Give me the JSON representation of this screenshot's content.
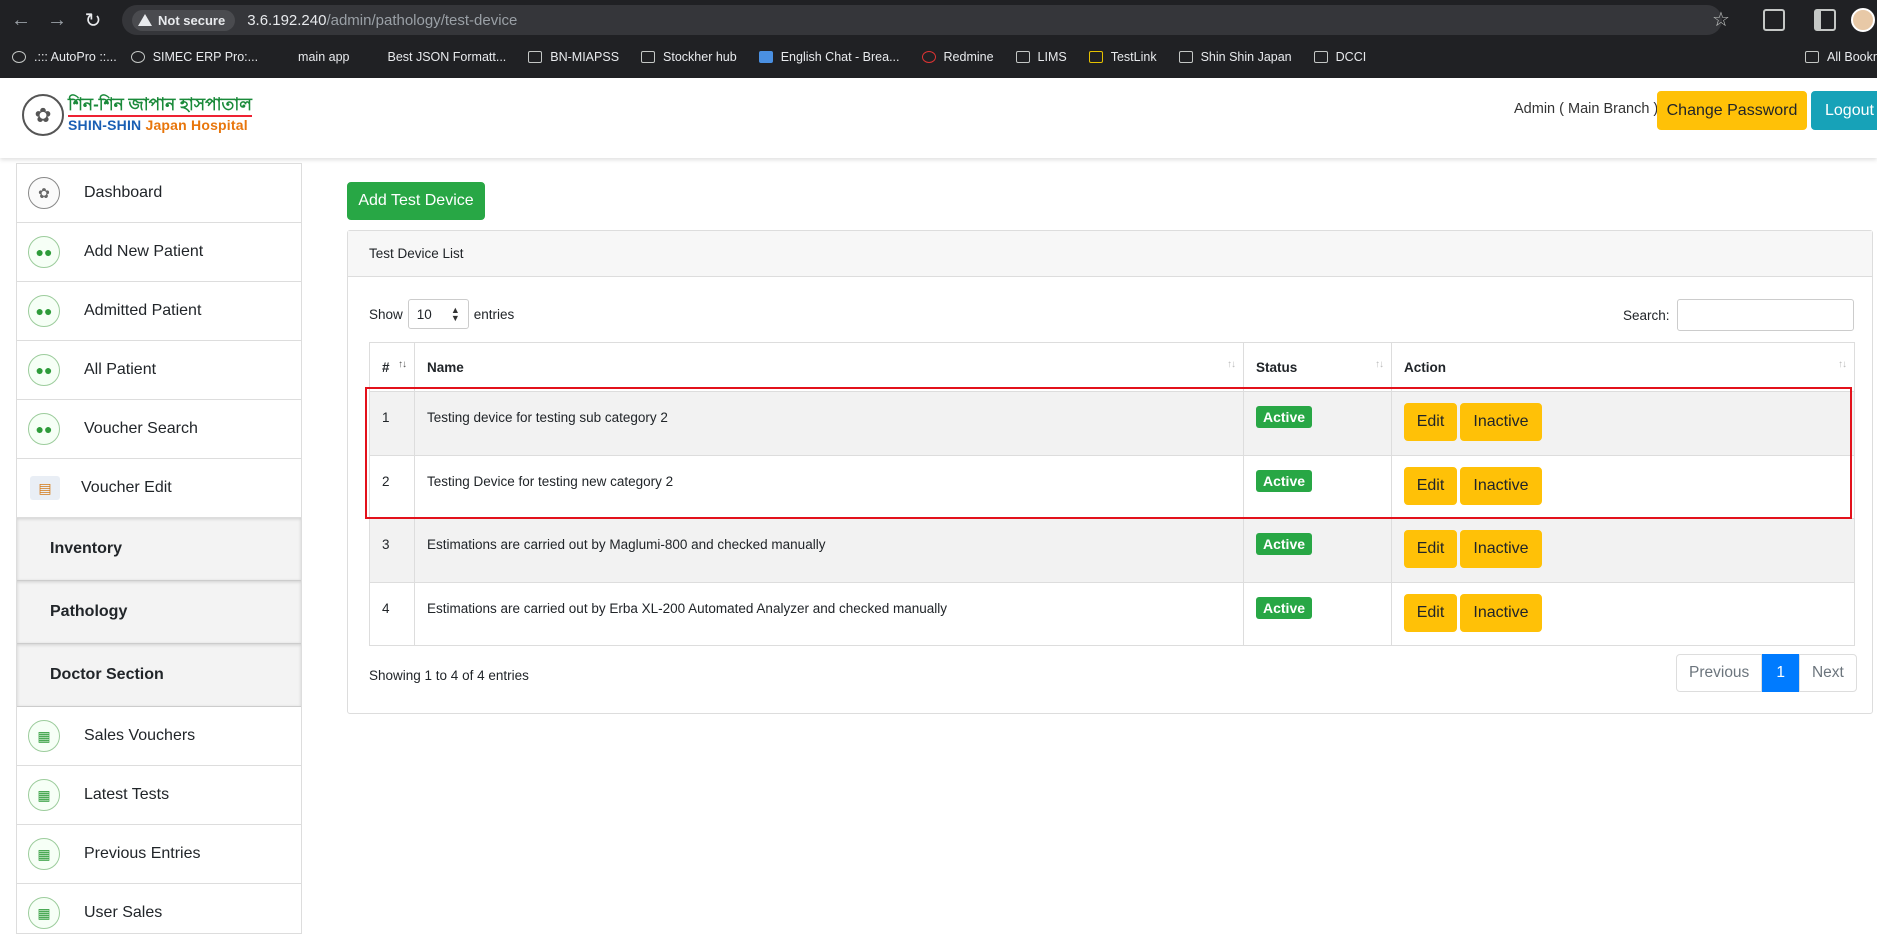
{
  "browser": {
    "security_label": "Not secure",
    "url_host": "3.6.192.240",
    "url_path": "/admin/pathology/test-device",
    "bookmarks": [
      ".::: AutoPro ::...",
      "SIMEC ERP Pro:...",
      "main app",
      "Best JSON Formatt...",
      "BN-MIAPSS",
      "Stockher hub",
      "English Chat - Brea...",
      "Redmine",
      "LIMS",
      "TestLink",
      "Shin Shin Japan",
      "DCCI"
    ],
    "all_bookmarks": "All Bookm"
  },
  "header": {
    "logo_bn": "শিন-শিন জাপান হাসপাতাল",
    "logo_en_1": "SHIN-SHIN",
    "logo_en_2": "Japan Hospital",
    "admin_label": "Admin ( Main Branch )",
    "change_password": "Change Password",
    "logout": "Logout"
  },
  "sidebar": {
    "items": [
      {
        "label": "Dashboard"
      },
      {
        "label": "Add New Patient"
      },
      {
        "label": "Admitted Patient"
      },
      {
        "label": "All Patient"
      },
      {
        "label": "Voucher Search"
      },
      {
        "label": "Voucher Edit"
      }
    ],
    "groups": [
      "Inventory",
      "Pathology",
      "Doctor Section"
    ],
    "items2": [
      {
        "label": "Sales Vouchers"
      },
      {
        "label": "Latest Tests"
      },
      {
        "label": "Previous Entries"
      },
      {
        "label": "User Sales"
      }
    ]
  },
  "main": {
    "add_button": "Add Test Device",
    "card_title": "Test Device List",
    "show_label": "Show",
    "entries_value": "10",
    "entries_label": "entries",
    "search_label": "Search:",
    "columns": [
      "#",
      "Name",
      "Status",
      "Action"
    ],
    "rows": [
      {
        "num": "1",
        "name": "Testing device for testing sub category 2",
        "status": "Active"
      },
      {
        "num": "2",
        "name": "Testing Device for testing new category 2",
        "status": "Active"
      },
      {
        "num": "3",
        "name": "Estimations are carried out by Maglumi-800 and checked manually",
        "status": "Active"
      },
      {
        "num": "4",
        "name": "Estimations are carried out by Erba XL-200 Automated Analyzer and checked manually",
        "status": "Active"
      }
    ],
    "edit_label": "Edit",
    "inactive_label": "Inactive",
    "showing_text": "Showing 1 to 4 of 4 entries",
    "pagination": {
      "previous": "Previous",
      "current": "1",
      "next": "Next"
    }
  },
  "colors": {
    "highlight": "#e3111b",
    "primary": "#007bff",
    "success": "#28a745",
    "warning": "#ffc107"
  }
}
